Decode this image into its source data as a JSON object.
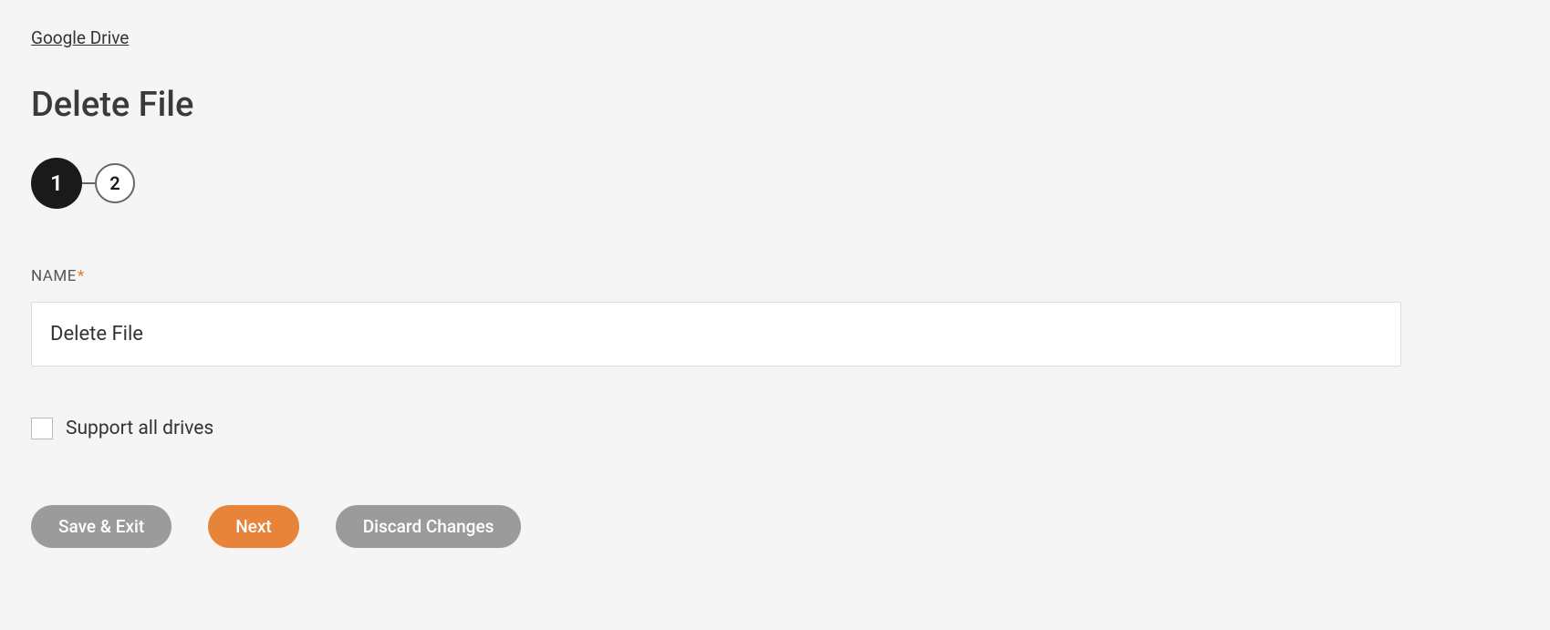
{
  "breadcrumb": {
    "label": "Google Drive"
  },
  "page": {
    "title": "Delete File"
  },
  "stepper": {
    "step1": "1",
    "step2": "2"
  },
  "form": {
    "name_label": "NAME",
    "required_mark": "*",
    "name_value": "Delete File",
    "checkbox_label": "Support all drives"
  },
  "buttons": {
    "save_exit": "Save & Exit",
    "next": "Next",
    "discard": "Discard Changes"
  }
}
